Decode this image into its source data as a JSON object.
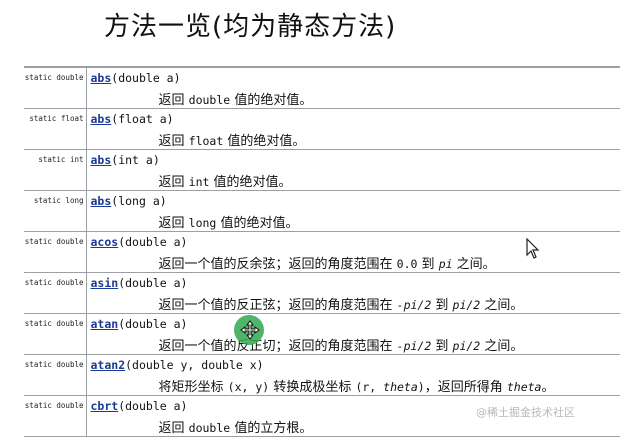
{
  "title": "方法一览(均为静态方法)",
  "methods": [
    {
      "modifier": "static double",
      "name": "abs",
      "params": "(double a)",
      "desc": [
        {
          "t": "返回 "
        },
        {
          "t": "double",
          "s": "code"
        },
        {
          "t": " 值的绝对值。"
        }
      ]
    },
    {
      "modifier": "static float",
      "name": "abs",
      "params": "(float a)",
      "desc": [
        {
          "t": "返回 "
        },
        {
          "t": "float",
          "s": "code"
        },
        {
          "t": " 值的绝对值。"
        }
      ]
    },
    {
      "modifier": "static int",
      "name": "abs",
      "params": "(int a)",
      "desc": [
        {
          "t": "返回 "
        },
        {
          "t": "int",
          "s": "code"
        },
        {
          "t": " 值的绝对值。"
        }
      ]
    },
    {
      "modifier": "static long",
      "name": "abs",
      "params": "(long a)",
      "desc": [
        {
          "t": "返回 "
        },
        {
          "t": "long",
          "s": "code"
        },
        {
          "t": " 值的绝对值。"
        }
      ]
    },
    {
      "modifier": "static double",
      "name": "acos",
      "params": "(double a)",
      "desc": [
        {
          "t": "返回一个值的反余弦；返回的角度范围在 "
        },
        {
          "t": "0.0",
          "s": "code"
        },
        {
          "t": " 到 "
        },
        {
          "t": "pi",
          "s": "code-i"
        },
        {
          "t": " 之间。"
        }
      ]
    },
    {
      "modifier": "static double",
      "name": "asin",
      "params": "(double a)",
      "desc": [
        {
          "t": "返回一个值的反正弦；返回的角度范围在 "
        },
        {
          "t": "-pi/2",
          "s": "code-i"
        },
        {
          "t": " 到 "
        },
        {
          "t": "pi/2",
          "s": "code-i"
        },
        {
          "t": " 之间。"
        }
      ]
    },
    {
      "modifier": "static double",
      "name": "atan",
      "params": "(double a)",
      "desc": [
        {
          "t": "返回一个值的反正切；返回的角度范围在 "
        },
        {
          "t": "-pi/2",
          "s": "code-i"
        },
        {
          "t": " 到 "
        },
        {
          "t": "pi/2",
          "s": "code-i"
        },
        {
          "t": " 之间。"
        }
      ]
    },
    {
      "modifier": "static double",
      "name": "atan2",
      "params": "(double y, double x)",
      "desc": [
        {
          "t": "将矩形坐标 "
        },
        {
          "t": "(x, y)",
          "s": "code"
        },
        {
          "t": " 转换成极坐标 "
        },
        {
          "t": "(r, ",
          "s": "code"
        },
        {
          "t": "theta",
          "s": "code-i"
        },
        {
          "t": ")",
          "s": "code"
        },
        {
          "t": "，返回所得角 "
        },
        {
          "t": "theta",
          "s": "code-i"
        },
        {
          "t": "。"
        }
      ]
    },
    {
      "modifier": "static double",
      "name": "cbrt",
      "params": "(double a)",
      "desc": [
        {
          "t": "返回 "
        },
        {
          "t": "double",
          "s": "code"
        },
        {
          "t": " 值的立方根。"
        }
      ]
    }
  ],
  "watermark": "@稀土掘金技术社区",
  "colors": {
    "link": "#1a3a96",
    "border": "#9aa0a6",
    "cursor_dot": "#2fa84f"
  }
}
